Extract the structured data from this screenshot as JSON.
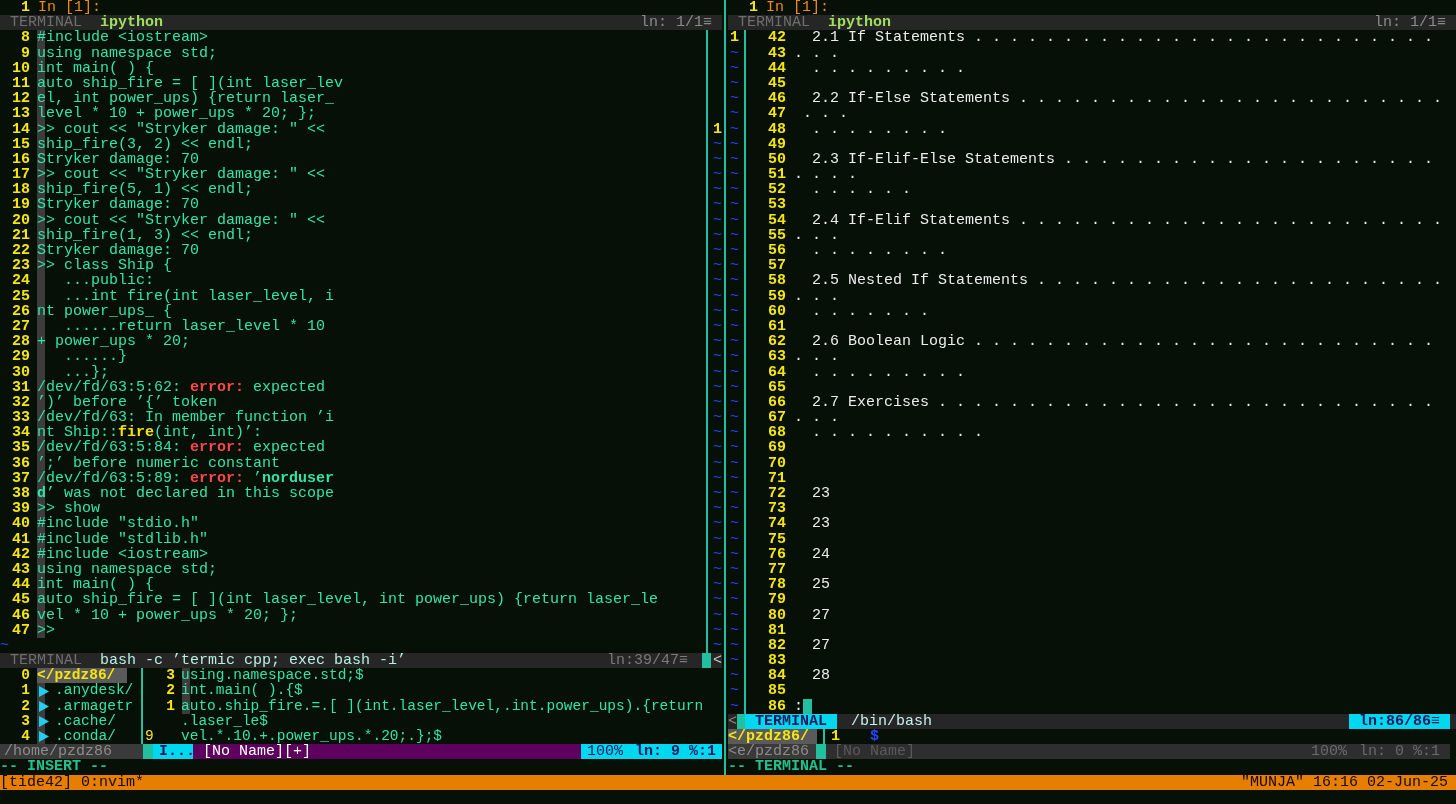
{
  "left_pane": {
    "prompt": {
      "number": "1",
      "text": "In [1]:"
    },
    "top_bar": {
      "label": "TERMINAL",
      "title": "ipython",
      "position": "ln: 1/1≡"
    },
    "lines": [
      {
        "kind": "line",
        "number": "8",
        "text": "#include <iostream>"
      },
      {
        "kind": "line",
        "number": "9",
        "text": "using namespace std;"
      },
      {
        "kind": "line",
        "number": "10",
        "text": "int main( ) {"
      },
      {
        "kind": "line",
        "number": "11",
        "text": "auto ship_fire = [ ](int laser_lev"
      },
      {
        "kind": "line",
        "number": "12",
        "text": "el, int power_ups) {return laser_"
      },
      {
        "kind": "line",
        "number": "13",
        "text": "level * 10 + power_ups * 20; };"
      },
      {
        "kind": "line",
        "number": "14",
        "text": ">> cout << \"Stryker damage: \" <<",
        "side": {
          "kind": "number",
          "text": "1"
        }
      },
      {
        "kind": "line",
        "number": "15",
        "text": "ship_fire(3, 2) << endl;",
        "side": {
          "kind": "filler",
          "text": "~"
        }
      },
      {
        "kind": "line",
        "number": "16",
        "text": "Stryker damage: 70",
        "side": {
          "kind": "filler",
          "text": "~"
        }
      },
      {
        "kind": "line",
        "number": "17",
        "text": ">> cout << \"Stryker damage: \" <<",
        "side": {
          "kind": "filler",
          "text": "~"
        }
      },
      {
        "kind": "line",
        "number": "18",
        "text": "ship_fire(5, 1) << endl;",
        "side": {
          "kind": "filler",
          "text": "~"
        }
      },
      {
        "kind": "line",
        "number": "19",
        "text": "Stryker damage: 70",
        "side": {
          "kind": "filler",
          "text": "~"
        }
      },
      {
        "kind": "line",
        "number": "20",
        "text": ">> cout << \"Stryker damage: \" <<",
        "side": {
          "kind": "filler",
          "text": "~"
        }
      },
      {
        "kind": "line",
        "number": "21",
        "text": "ship_fire(1, 3) << endl;",
        "side": {
          "kind": "filler",
          "text": "~"
        }
      },
      {
        "kind": "line",
        "number": "22",
        "text": "Stryker damage: 70",
        "side": {
          "kind": "filler",
          "text": "~"
        }
      },
      {
        "kind": "line",
        "number": "23",
        "text": ">> class Ship {",
        "side": {
          "kind": "filler",
          "text": "~"
        }
      },
      {
        "kind": "line",
        "number": "24",
        "text": "   ...public:",
        "side": {
          "kind": "filler",
          "text": "~"
        }
      },
      {
        "kind": "line",
        "number": "25",
        "text": "   ...int fire(int laser_level, i",
        "side": {
          "kind": "filler",
          "text": "~"
        }
      },
      {
        "kind": "line",
        "number": "26",
        "text": "nt power_ups_ {",
        "side": {
          "kind": "filler",
          "text": "~"
        }
      },
      {
        "kind": "line",
        "number": "27",
        "text": "   ......return laser_level * 10",
        "side": {
          "kind": "filler",
          "text": "~"
        }
      },
      {
        "kind": "line",
        "number": "28",
        "text": "+ power_ups * 20;",
        "side": {
          "kind": "filler",
          "text": "~"
        }
      },
      {
        "kind": "line",
        "number": "29",
        "text": "   ......}",
        "side": {
          "kind": "filler",
          "text": "~"
        }
      },
      {
        "kind": "line",
        "number": "30",
        "text": "   ...};",
        "side": {
          "kind": "filler",
          "text": "~"
        }
      },
      {
        "kind": "line",
        "number": "31",
        "segments": [
          {
            "kind": "code",
            "text": "/dev/fd/63:5:62: "
          },
          {
            "kind": "error",
            "text": "error:"
          },
          {
            "kind": "code",
            "text": " expected"
          }
        ],
        "side": {
          "kind": "filler",
          "text": "~"
        }
      },
      {
        "kind": "line",
        "number": "32",
        "text": "’)’ before ’{’ token",
        "side": {
          "kind": "filler",
          "text": "~"
        }
      },
      {
        "kind": "line",
        "number": "33",
        "text": "/dev/fd/63: In member function ’i",
        "side": {
          "kind": "filler",
          "text": "~"
        }
      },
      {
        "kind": "line",
        "number": "34",
        "segments": [
          {
            "kind": "code",
            "text": "nt Ship::"
          },
          {
            "kind": "func",
            "text": "fire"
          },
          {
            "kind": "code",
            "text": "(int, int)’:"
          }
        ],
        "side": {
          "kind": "filler",
          "text": "~"
        }
      },
      {
        "kind": "line",
        "number": "35",
        "segments": [
          {
            "kind": "code",
            "text": "/dev/fd/63:5:84: "
          },
          {
            "kind": "error",
            "text": "error:"
          },
          {
            "kind": "code",
            "text": " expected"
          }
        ],
        "side": {
          "kind": "filler",
          "text": "~"
        }
      },
      {
        "kind": "line",
        "number": "36",
        "text": "’;’ before numeric constant",
        "side": {
          "kind": "filler",
          "text": "~"
        }
      },
      {
        "kind": "line",
        "number": "37",
        "segments": [
          {
            "kind": "code",
            "text": "/dev/fd/63:5:89: "
          },
          {
            "kind": "error",
            "text": "error:"
          },
          {
            "kind": "code",
            "text": " ’"
          },
          {
            "kind": "bold",
            "text": "norduser"
          }
        ],
        "side": {
          "kind": "filler",
          "text": "~"
        }
      },
      {
        "kind": "line",
        "number": "38",
        "segments": [
          {
            "kind": "bold",
            "text": "d"
          },
          {
            "kind": "code",
            "text": "’ was not declared in this scope"
          }
        ],
        "side": {
          "kind": "filler",
          "text": "~"
        }
      },
      {
        "kind": "line",
        "number": "39",
        "text": ">> show",
        "side": {
          "kind": "filler",
          "text": "~"
        }
      },
      {
        "kind": "line",
        "number": "40",
        "text": "#include \"stdio.h\"",
        "side": {
          "kind": "filler",
          "text": "~"
        }
      },
      {
        "kind": "line",
        "number": "41",
        "text": "#include \"stdlib.h\"",
        "side": {
          "kind": "filler",
          "text": "~"
        }
      },
      {
        "kind": "line",
        "number": "42",
        "text": "#include <iostream>",
        "side": {
          "kind": "filler",
          "text": "~"
        }
      },
      {
        "kind": "line",
        "number": "43",
        "text": "using namespace std;",
        "side": {
          "kind": "filler",
          "text": "~"
        }
      },
      {
        "kind": "line",
        "number": "44",
        "text": "int main( ) {",
        "side": {
          "kind": "filler",
          "text": "~"
        }
      },
      {
        "kind": "line",
        "number": "45",
        "text": "auto ship_fire = [ ](int laser_level, int power_ups) {return laser_le",
        "side": {
          "kind": "filler",
          "text": "~"
        }
      },
      {
        "kind": "line",
        "number": "46",
        "text": "vel * 10 + power_ups * 20; };",
        "side": {
          "kind": "filler",
          "text": "~"
        }
      },
      {
        "kind": "line",
        "number": "47",
        "text": ">>",
        "side": {
          "kind": "filler",
          "text": "~"
        }
      },
      {
        "kind": "end",
        "text": "~",
        "side": {
          "kind": "filler",
          "text": "~"
        }
      }
    ],
    "bottom_bar": {
      "label": "TERMINAL",
      "title": "bash -c ’termic cpp; exec bash -i’",
      "position": "ln:39/47≡",
      "arrow": "<"
    },
    "tree": [
      {
        "kind": "root",
        "number": "0",
        "name": "</pzdz86/",
        "selected": true
      },
      {
        "kind": "folder",
        "number": "1",
        "name": ".anydesk/",
        "selected": false
      },
      {
        "kind": "folder",
        "number": "2",
        "name": ".armagetr",
        "selected": false
      },
      {
        "kind": "folder",
        "number": "3",
        "name": ".cache/",
        "selected": false
      },
      {
        "kind": "folder",
        "number": "4",
        "name": ".conda/",
        "selected": false
      }
    ],
    "editor_lines": [
      {
        "number": "3",
        "text": "using.namespace.std;$",
        "current": false
      },
      {
        "number": "2",
        "text": "int.main( ).{$",
        "current": false
      },
      {
        "number": "1",
        "text": "auto.ship_fire.=.[ ](int.laser_level,.int.power_ups).{return",
        "current": false
      },
      {
        "text": ".laser_le$"
      },
      {
        "number": "9",
        "text": "vel.*.10.+.power_ups.*.20;.};$",
        "current": true
      }
    ],
    "status": {
      "path": "/home/pzdz86",
      "mode": "I...",
      "file": "[No Name][+]",
      "percent": "100%",
      "position": "ln: 9 %:1"
    },
    "mode_line": "-- INSERT --"
  },
  "right_pane": {
    "prompt": {
      "number": "1",
      "text": "In [1]:"
    },
    "top_bar": {
      "label": "TERMINAL",
      "title": "ipython",
      "position": "ln: 1/1≡"
    },
    "lines": [
      {
        "marker": {
          "kind": "number",
          "text": "1"
        },
        "number": "42",
        "text": "  2.1 If Statements . . . . . . . . . . . . . . . . . . . . . . . . . ."
      },
      {
        "marker": {
          "kind": "filler",
          "text": "~"
        },
        "number": "43",
        "text": ". . ."
      },
      {
        "marker": {
          "kind": "filler",
          "text": "~"
        },
        "number": "44",
        "text": "  . . . . . . . . ."
      },
      {
        "marker": {
          "kind": "filler",
          "text": "~"
        },
        "number": "45"
      },
      {
        "marker": {
          "kind": "filler",
          "text": "~"
        },
        "number": "46",
        "text": "  2.2 If-Else Statements . . . . . . . . . . . . . . . . . . . . . . . ."
      },
      {
        "marker": {
          "kind": "filler",
          "text": "~"
        },
        "number": "47",
        "text": " . . ."
      },
      {
        "marker": {
          "kind": "filler",
          "text": "~"
        },
        "number": "48",
        "text": "  . . . . . . . ."
      },
      {
        "marker": {
          "kind": "filler",
          "text": "~"
        },
        "number": "49"
      },
      {
        "marker": {
          "kind": "filler",
          "text": "~"
        },
        "number": "50",
        "text": "  2.3 If-Elif-Else Statements . . . . . . . . . . . . . . . . . . . . ."
      },
      {
        "marker": {
          "kind": "filler",
          "text": "~"
        },
        "number": "51",
        "text": ". . . ."
      },
      {
        "marker": {
          "kind": "filler",
          "text": "~"
        },
        "number": "52",
        "text": "  . . . . . ."
      },
      {
        "marker": {
          "kind": "filler",
          "text": "~"
        },
        "number": "53"
      },
      {
        "marker": {
          "kind": "filler",
          "text": "~"
        },
        "number": "54",
        "text": "  2.4 If-Elif Statements . . . . . . . . . . . . . . . . . . . . . . . ."
      },
      {
        "marker": {
          "kind": "filler",
          "text": "~"
        },
        "number": "55",
        "text": ". . ."
      },
      {
        "marker": {
          "kind": "filler",
          "text": "~"
        },
        "number": "56",
        "text": "  . . . . . . . ."
      },
      {
        "marker": {
          "kind": "filler",
          "text": "~"
        },
        "number": "57"
      },
      {
        "marker": {
          "kind": "filler",
          "text": "~"
        },
        "number": "58",
        "text": "  2.5 Nested If Statements . . . . . . . . . . . . . . . . . . . . . . ."
      },
      {
        "marker": {
          "kind": "filler",
          "text": "~"
        },
        "number": "59",
        "text": ". . ."
      },
      {
        "marker": {
          "kind": "filler",
          "text": "~"
        },
        "number": "60",
        "text": "  . . . . . . ."
      },
      {
        "marker": {
          "kind": "filler",
          "text": "~"
        },
        "number": "61"
      },
      {
        "marker": {
          "kind": "filler",
          "text": "~"
        },
        "number": "62",
        "text": "  2.6 Boolean Logic . . . . . . . . . . . . . . . . . . . . . . . . . ."
      },
      {
        "marker": {
          "kind": "filler",
          "text": "~"
        },
        "number": "63",
        "text": ". . ."
      },
      {
        "marker": {
          "kind": "filler",
          "text": "~"
        },
        "number": "64",
        "text": "  . . . . . . . . ."
      },
      {
        "marker": {
          "kind": "filler",
          "text": "~"
        },
        "number": "65"
      },
      {
        "marker": {
          "kind": "filler",
          "text": "~"
        },
        "number": "66",
        "text": "  2.7 Exercises . . . . . . . . . . . . . . . . . . . . . . . . . . . ."
      },
      {
        "marker": {
          "kind": "filler",
          "text": "~"
        },
        "number": "67",
        "text": ". . ."
      },
      {
        "marker": {
          "kind": "filler",
          "text": "~"
        },
        "number": "68",
        "text": "  . . . . . . . . . ."
      },
      {
        "marker": {
          "kind": "filler",
          "text": "~"
        },
        "number": "69"
      },
      {
        "marker": {
          "kind": "filler",
          "text": "~"
        },
        "number": "70"
      },
      {
        "marker": {
          "kind": "filler",
          "text": "~"
        },
        "number": "71"
      },
      {
        "marker": {
          "kind": "filler",
          "text": "~"
        },
        "number": "72",
        "text": "  23"
      },
      {
        "marker": {
          "kind": "filler",
          "text": "~"
        },
        "number": "73"
      },
      {
        "marker": {
          "kind": "filler",
          "text": "~"
        },
        "number": "74",
        "text": "  23"
      },
      {
        "marker": {
          "kind": "filler",
          "text": "~"
        },
        "number": "75"
      },
      {
        "marker": {
          "kind": "filler",
          "text": "~"
        },
        "number": "76",
        "text": "  24"
      },
      {
        "marker": {
          "kind": "filler",
          "text": "~"
        },
        "number": "77"
      },
      {
        "marker": {
          "kind": "filler",
          "text": "~"
        },
        "number": "78",
        "text": "  25"
      },
      {
        "marker": {
          "kind": "filler",
          "text": "~"
        },
        "number": "79"
      },
      {
        "marker": {
          "kind": "filler",
          "text": "~"
        },
        "number": "80",
        "text": "  27"
      },
      {
        "marker": {
          "kind": "filler",
          "text": "~"
        },
        "number": "81"
      },
      {
        "marker": {
          "kind": "filler",
          "text": "~"
        },
        "number": "82",
        "text": "  27"
      },
      {
        "marker": {
          "kind": "filler",
          "text": "~"
        },
        "number": "83"
      },
      {
        "marker": {
          "kind": "filler",
          "text": "~"
        },
        "number": "84",
        "text": "  28"
      },
      {
        "marker": {
          "kind": "filler",
          "text": "~"
        },
        "number": "85"
      },
      {
        "marker": {
          "kind": "filler",
          "text": "~"
        },
        "number": "86",
        "text": ":"
      }
    ],
    "bottom_bar": {
      "arrow": "<",
      "label": "TERMINAL",
      "title": "/bin/bash",
      "position": "ln:86/86≡"
    },
    "shell": {
      "path": "</pzdz86/",
      "number": "1",
      "prompt": "$"
    },
    "status": {
      "path": "<e/pzdz86",
      "file": "[No Name]",
      "percent": "100%",
      "position": "ln: 0 %:1"
    },
    "mode_line": "-- TERMINAL --"
  },
  "tmux": {
    "session": "[tide42] 0:nvim*",
    "status": "\"MUNJA\" 16:16 02-Jun-25"
  }
}
